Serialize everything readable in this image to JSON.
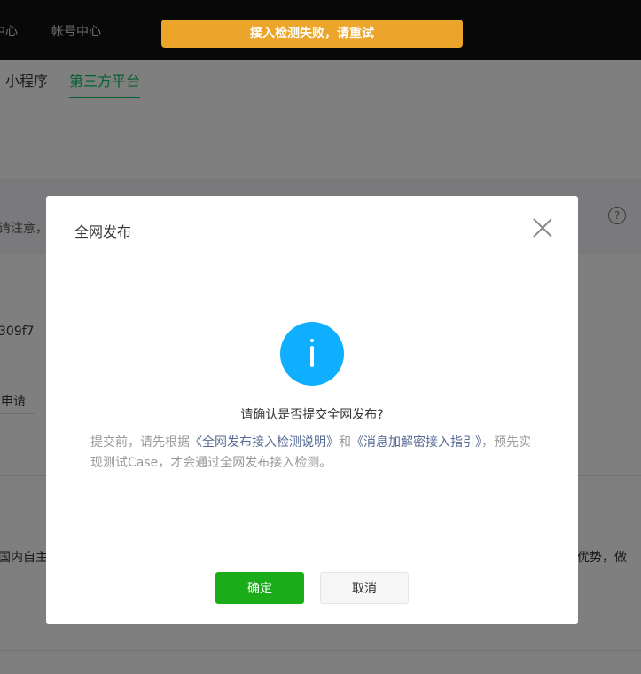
{
  "topnav": {
    "item_left": "中心",
    "item_account": "帐号中心"
  },
  "toast": {
    "message": "接入检测失败，请重试",
    "color": "#eba52b"
  },
  "tabs": [
    {
      "label": "小程序",
      "active": false
    },
    {
      "label": "第三方平台",
      "active": true
    }
  ],
  "notice": {
    "text_fragment": "请注意，"
  },
  "page": {
    "appid_fragment": "309f7",
    "apply_button_fragment": "申请",
    "body_left_fragment": "国内自主",
    "body_right_fragment": "先优势，做"
  },
  "modal": {
    "title": "全网发布",
    "question": "请确认是否提交全网发布?",
    "desc_prefix": "提交前，请先根据",
    "desc_link1": "《全网发布接入检测说明》",
    "desc_and": "和",
    "desc_link2": "《消息加解密接入指引》",
    "desc_suffix": "，预先实现测试Case，才会通过全网发布接入检测。",
    "confirm_label": "确定",
    "cancel_label": "取消"
  },
  "colors": {
    "accent_green": "#07c160",
    "primary_button": "#1aad19",
    "info_icon": "#10aeff",
    "link": "#576b95"
  }
}
